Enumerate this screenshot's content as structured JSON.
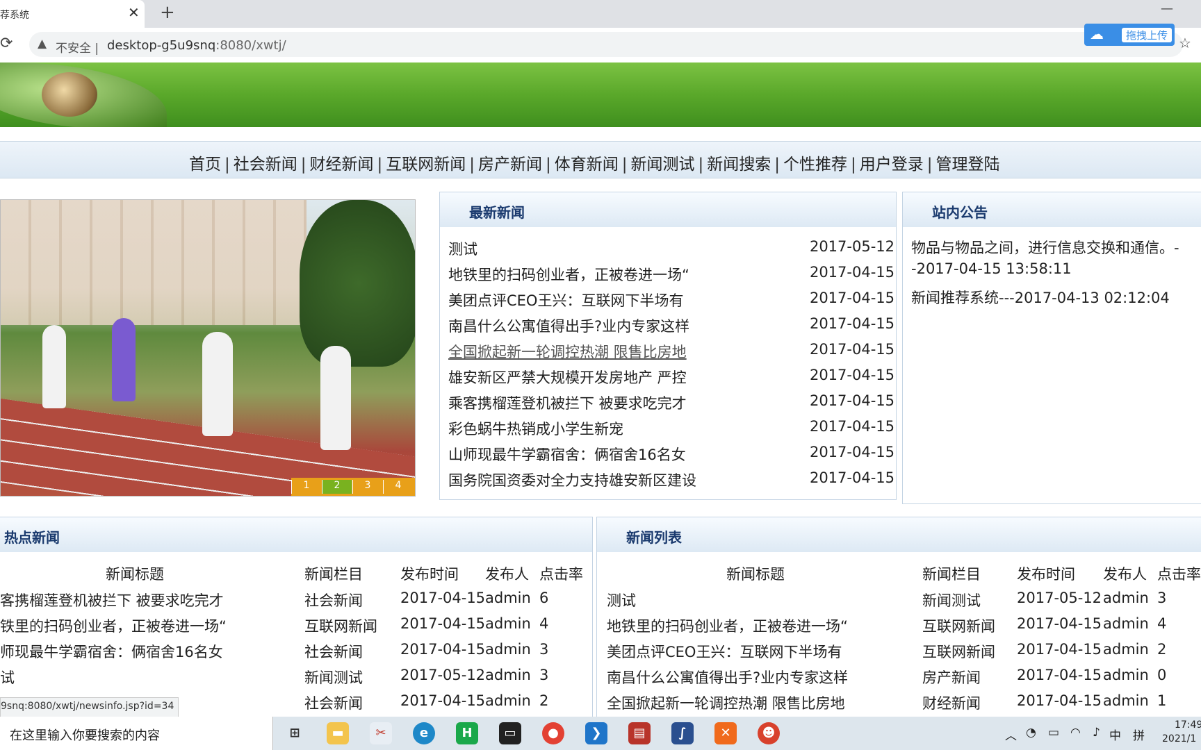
{
  "browser": {
    "tab_title": "荐系统",
    "insecure_label": "不安全",
    "url_host": "desktop-g5u9snq",
    "url_rest": ":8080/xwtj/",
    "upload_button": "拖拽上传"
  },
  "nav": {
    "items": [
      "首页",
      "社会新闻",
      "财经新闻",
      "互联网新闻",
      "房产新闻",
      "体育新闻",
      "新闻测试",
      "新闻搜索",
      "个性推荐",
      "用户登录",
      "管理登陆"
    ],
    "separator": "|"
  },
  "slider": {
    "pages": [
      "1",
      "2",
      "3",
      "4"
    ],
    "active_page": 2
  },
  "latest_news": {
    "title": "最新新闻",
    "items": [
      {
        "title": "测试",
        "date": "2017-05-12"
      },
      {
        "title": "地铁里的扫码创业者，正被卷进一场“",
        "date": "2017-04-15"
      },
      {
        "title": "美团点评CEO王兴：互联网下半场有",
        "date": "2017-04-15"
      },
      {
        "title": "南昌什么公寓值得出手?业内专家这样",
        "date": "2017-04-15"
      },
      {
        "title": "全国掀起新一轮调控热潮 限售比房地",
        "date": "2017-04-15"
      },
      {
        "title": "雄安新区严禁大规模开发房地产 严控",
        "date": "2017-04-15"
      },
      {
        "title": "乘客携榴莲登机被拦下 被要求吃完才",
        "date": "2017-04-15"
      },
      {
        "title": "彩色蜗牛热销成小学生新宠",
        "date": "2017-04-15"
      },
      {
        "title": "山师现最牛学霸宿舍：俩宿舍16名女",
        "date": "2017-04-15"
      },
      {
        "title": "国务院国资委对全力支持雄安新区建设",
        "date": "2017-04-15"
      }
    ]
  },
  "notice": {
    "title": "站内公告",
    "lines": [
      "物品与物品之间，进行信息交换和通信。-",
      "-2017-04-15 13:58:11",
      "新闻推荐系统---2017-04-13 02:12:04"
    ]
  },
  "hot_news": {
    "title": "热点新闻",
    "headers": [
      "新闻标题",
      "新闻栏目",
      "发布时间",
      "发布人",
      "点击率"
    ],
    "rows": [
      [
        "客携榴莲登机被拦下 被要求吃完才",
        "社会新闻",
        "2017-04-15",
        "admin",
        "6"
      ],
      [
        "铁里的扫码创业者，正被卷进一场“",
        "互联网新闻",
        "2017-04-15",
        "admin",
        "4"
      ],
      [
        "师现最牛学霸宿舍：俩宿舍16名女",
        "社会新闻",
        "2017-04-15",
        "admin",
        "3"
      ],
      [
        "试",
        "新闻测试",
        "2017-05-12",
        "admin",
        "3"
      ],
      [
        "",
        "社会新闻",
        "2017-04-15",
        "admin",
        "2"
      ]
    ]
  },
  "news_list": {
    "title": "新闻列表",
    "headers": [
      "新闻标题",
      "新闻栏目",
      "发布时间",
      "发布人",
      "点击率"
    ],
    "rows": [
      [
        "测试",
        "新闻测试",
        "2017-05-12",
        "admin",
        "3"
      ],
      [
        "地铁里的扫码创业者，正被卷进一场“",
        "互联网新闻",
        "2017-04-15",
        "admin",
        "4"
      ],
      [
        "美团点评CEO王兴：互联网下半场有",
        "互联网新闻",
        "2017-04-15",
        "admin",
        "2"
      ],
      [
        "南昌什么公寓值得出手?业内专家这样",
        "房产新闻",
        "2017-04-15",
        "admin",
        "0"
      ],
      [
        "全国掀起新一轮调控热潮 限售比房地",
        "财经新闻",
        "2017-04-15",
        "admin",
        "1"
      ]
    ]
  },
  "status_url": "9snq:8080/xwtj/newsinfo.jsp?id=34",
  "taskbar": {
    "search_placeholder": "在这里输入你要搜索的内容",
    "ime_mode": "中",
    "ime_pinyin": "拼",
    "clock_time": "17:49",
    "clock_date": "2021/1"
  }
}
